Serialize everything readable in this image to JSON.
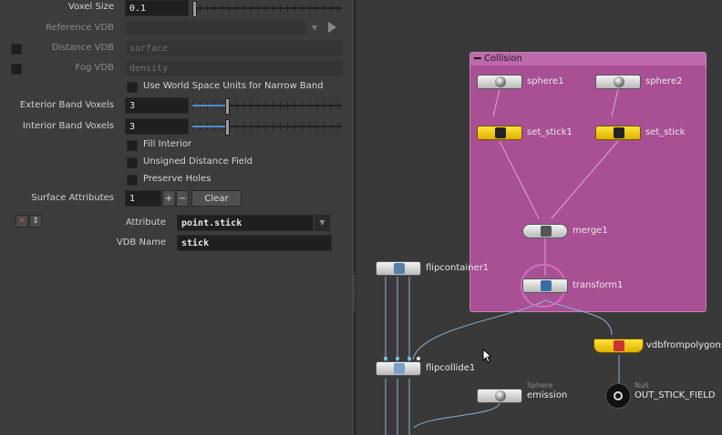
{
  "params": {
    "voxel_size": {
      "label": "Voxel Size",
      "value": "0.1",
      "fill": 0.01
    },
    "reference_vdb": {
      "label": "Reference VDB",
      "value": ""
    },
    "distance_vdb": {
      "label": "Distance VDB",
      "value": "surface"
    },
    "fog_vdb": {
      "label": "Fog VDB",
      "value": "density"
    },
    "world_space_units": {
      "label": "Use World Space Units for Narrow Band",
      "checked": false
    },
    "exterior_band": {
      "label": "Exterior Band Voxels",
      "value": "3",
      "fill": 0.23
    },
    "interior_band": {
      "label": "Interior Band Voxels",
      "value": "3",
      "fill": 0.23
    },
    "fill_interior": {
      "label": "Fill Interior",
      "checked": false
    },
    "unsigned_distance": {
      "label": "Unsigned Distance Field",
      "checked": false
    },
    "preserve_holes": {
      "label": "Preserve Holes",
      "checked": false
    },
    "surface_attributes": {
      "label": "Surface Attributes",
      "value": "1",
      "plus": "+",
      "minus": "−",
      "clear": "Clear"
    },
    "multi": {
      "remove": "×",
      "reorder": "⇕"
    },
    "attribute": {
      "label": "Attribute",
      "value": "point.stick"
    },
    "vdb_name": {
      "label": "VDB Name",
      "value": "stick"
    }
  },
  "network": {
    "box_title": "Collision",
    "nodes": {
      "sphere1": "sphere1",
      "sphere2": "sphere2",
      "set_stick1": "set_stick1",
      "set_stick": "set_stick",
      "merge1": "merge1",
      "transform1": "transform1",
      "flipcontainer1": "flipcontainer1",
      "flipcollide1": "flipcollide1",
      "emission": "emission",
      "emission_type": "Sphere",
      "vdbfrompolygons": "vdbfrompolygons",
      "null_type": "Null",
      "out_stick_field": "OUT_STICK_FIELD"
    }
  },
  "colors": {
    "netbox": "#b0529a",
    "slider_fill": "#4a8fd0",
    "yellow_node": "#ffd21c"
  }
}
